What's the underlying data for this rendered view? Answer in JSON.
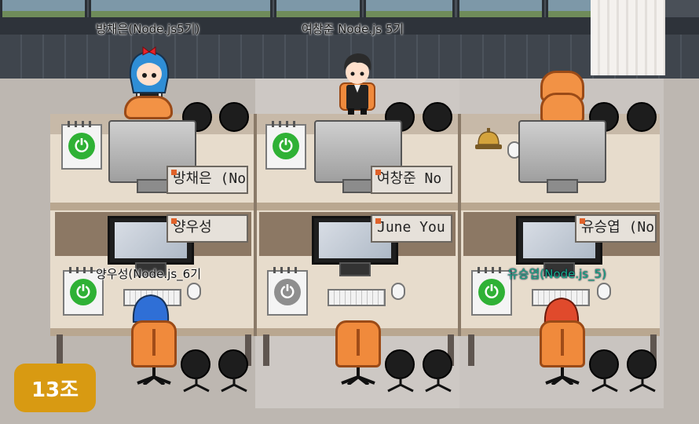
{
  "players": [
    {
      "label": "방채은(Node.js5기)",
      "style": "dark"
    },
    {
      "label": "여창준 Node.js 5기",
      "style": "dark"
    },
    {
      "label": "양우성(Node.js_6기",
      "style": "dark"
    },
    {
      "label": "유승엽(Node.js_5)",
      "style": "teal"
    }
  ],
  "nameplates": {
    "top": [
      "방채은 (No",
      "여창준 No",
      ""
    ],
    "bottom": [
      "양우성",
      "June You",
      "유승엽 (No"
    ]
  },
  "power_icons": {
    "top_left": {
      "state": "on",
      "color": "#2fb135"
    },
    "top_mid": {
      "state": "on",
      "color": "#2fb135"
    },
    "bottom_left": {
      "state": "on",
      "color": "#2fb135"
    },
    "bottom_mid": {
      "state": "off",
      "color": "#8e8e8e"
    },
    "bottom_right": {
      "state": "on",
      "color": "#2fb135"
    },
    "glyph": "⏻"
  },
  "room_badge": {
    "label": "13조",
    "color": "#d89a12"
  },
  "colors": {
    "chair_orange": "#f08a3c",
    "accent_teal": "#19b08c"
  }
}
